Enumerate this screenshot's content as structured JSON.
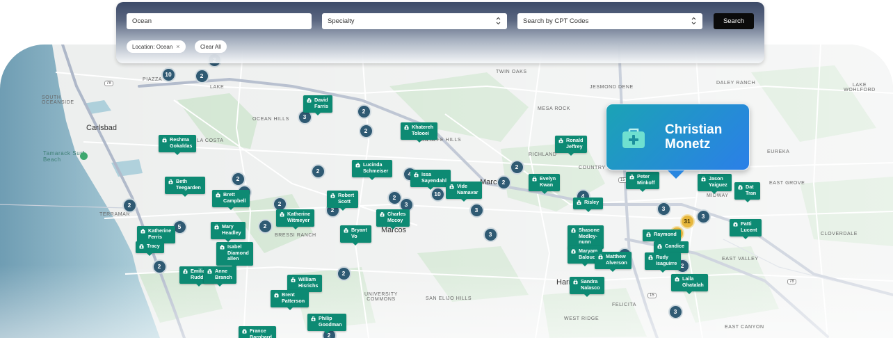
{
  "search": {
    "location_value": "Ocean",
    "specialty_placeholder": "Specialty",
    "cpt_placeholder": "Search by CPT Codes",
    "search_label": "Search"
  },
  "filters": {
    "chips": [
      {
        "label": "Location: Ocean",
        "remove": "×"
      },
      {
        "label": "Clear All"
      }
    ]
  },
  "callout": {
    "name": "Christian Monetz"
  },
  "map": {
    "place_labels": [
      "SOUTH OCEANSIDE",
      "LAKE",
      "OCEAN HILLS",
      "LA COSTA",
      "TWIN OAKS",
      "JESMOND DENE",
      "DALEY RANCH",
      "LAKE WOHLFORD",
      "MESA ROCK",
      "SANTA FE HILLS",
      "RICHLAND",
      "COUNTRY CLUB",
      "EUREKA",
      "EAST GROVE",
      "TERRAMAR",
      "BRESSI RANCH",
      "MIDWAY",
      "CLOVERDALE",
      "EAST VALLEY",
      "UNIVERSITY COMMONS",
      "SAN ELIJO HILLS",
      "FELICITA",
      "WEST RIDGE",
      "EAST CANYON",
      "PIAZZA"
    ],
    "city_labels": [
      "Carlsbad",
      "Marcos",
      "Marcos",
      "Harm Grov"
    ],
    "beach_label": "Tamarack Surf Beach",
    "road_labels": [
      "78",
      "15",
      "15",
      "78"
    ],
    "providers": [
      "David Farris",
      "Khatereh Tolooei",
      "Reshma Gokaldas",
      "Ronald Jeffrey",
      "Lucinda Schmeiser",
      "Beth Teegarden",
      "Brett Campbell",
      "Robert Scott",
      "Issa Sayendahl",
      "Vide Namavar",
      "Evelyn Kwan",
      "Peter Minkoff",
      "Jason Yaiguez",
      "Dat Tran",
      "Katherine Witmeyer",
      "Charles Mccoy",
      "Bryant Vo",
      "Risley",
      "Katherine Ferris",
      "Tracy",
      "Mary Headley",
      "Isabel Diamond allen",
      "Shasone Medley-nunn",
      "Maryam Balouch",
      "Matthew Alverson",
      "Raymond",
      "Candice",
      "Rudy Isaguirre",
      "Patti Lucent",
      "Emilianne Rudd",
      "Anne Branch",
      "William Hisrichs",
      "Brent Patterson",
      "Philip Goodman",
      "Sandra Nalasco",
      "Laila Ghatalah",
      "France Barnhard"
    ],
    "clusters": [
      "10",
      "2",
      "2",
      "2",
      "3",
      "2",
      "2",
      "4",
      "2",
      "4",
      "2",
      "2",
      "2",
      "3",
      "2",
      "2",
      "5",
      "10",
      "2",
      "3",
      "4",
      "3",
      "3",
      "31",
      "12",
      "3",
      "2",
      "6",
      "2",
      "2",
      "2",
      "3",
      "2",
      "2"
    ]
  }
}
